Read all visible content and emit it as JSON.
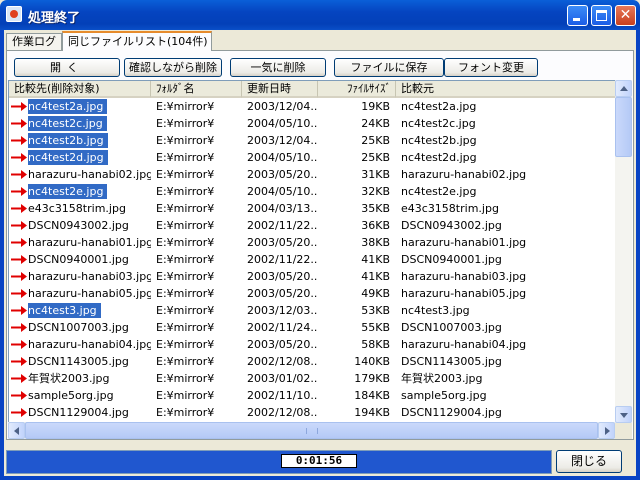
{
  "window": {
    "title": "処理終了",
    "colors": {
      "titlebar": "#0544c0",
      "selection": "#316ac5",
      "arrow": "#e00000",
      "status_bar": "#2057cf"
    }
  },
  "tabs": [
    {
      "label": "作業ログ",
      "active": false
    },
    {
      "label": "同じファイルリスト(104件)",
      "active": true
    }
  ],
  "toolbar": {
    "open": "開く",
    "confirm_delete": "確認しながら削除",
    "bulk_delete": "一気に削除",
    "save_to_file": "ファイルに保存",
    "change_font": "フォント変更"
  },
  "columns": [
    "比較先(削除対象)",
    "ﾌｫﾙﾀﾞ名",
    "更新日時",
    "ﾌｧｲﾙｻｲｽﾞ",
    "比較元"
  ],
  "rows": [
    {
      "target": "nc4test2a.jpg",
      "folder": "E:¥mirror¥",
      "date": "2003/12/04...",
      "size": "19KB",
      "source": "nc4test2a.jpg",
      "selected": true
    },
    {
      "target": "nc4test2c.jpg",
      "folder": "E:¥mirror¥",
      "date": "2004/05/10...",
      "size": "24KB",
      "source": "nc4test2c.jpg",
      "selected": true
    },
    {
      "target": "nc4test2b.jpg",
      "folder": "E:¥mirror¥",
      "date": "2003/12/04...",
      "size": "25KB",
      "source": "nc4test2b.jpg",
      "selected": true
    },
    {
      "target": "nc4test2d.jpg",
      "folder": "E:¥mirror¥",
      "date": "2004/05/10...",
      "size": "25KB",
      "source": "nc4test2d.jpg",
      "selected": true
    },
    {
      "target": "harazuru-hanabi02.jpg",
      "folder": "E:¥mirror¥",
      "date": "2003/05/20...",
      "size": "31KB",
      "source": "harazuru-hanabi02.jpg",
      "selected": false
    },
    {
      "target": "nc4test2e.jpg",
      "folder": "E:¥mirror¥",
      "date": "2004/05/10...",
      "size": "32KB",
      "source": "nc4test2e.jpg",
      "selected": true
    },
    {
      "target": "e43c3158trim.jpg",
      "folder": "E:¥mirror¥",
      "date": "2004/03/13...",
      "size": "35KB",
      "source": "e43c3158trim.jpg",
      "selected": false
    },
    {
      "target": "DSCN0943002.jpg",
      "folder": "E:¥mirror¥",
      "date": "2002/11/22...",
      "size": "36KB",
      "source": "DSCN0943002.jpg",
      "selected": false
    },
    {
      "target": "harazuru-hanabi01.jpg",
      "folder": "E:¥mirror¥",
      "date": "2003/05/20...",
      "size": "38KB",
      "source": "harazuru-hanabi01.jpg",
      "selected": false
    },
    {
      "target": "DSCN0940001.jpg",
      "folder": "E:¥mirror¥",
      "date": "2002/11/22...",
      "size": "41KB",
      "source": "DSCN0940001.jpg",
      "selected": false
    },
    {
      "target": "harazuru-hanabi03.jpg",
      "folder": "E:¥mirror¥",
      "date": "2003/05/20...",
      "size": "41KB",
      "source": "harazuru-hanabi03.jpg",
      "selected": false
    },
    {
      "target": "harazuru-hanabi05.jpg",
      "folder": "E:¥mirror¥",
      "date": "2003/05/20...",
      "size": "49KB",
      "source": "harazuru-hanabi05.jpg",
      "selected": false
    },
    {
      "target": "nc4test3.jpg",
      "folder": "E:¥mirror¥",
      "date": "2003/12/03...",
      "size": "53KB",
      "source": "nc4test3.jpg",
      "selected": true
    },
    {
      "target": "DSCN1007003.jpg",
      "folder": "E:¥mirror¥",
      "date": "2002/11/24...",
      "size": "55KB",
      "source": "DSCN1007003.jpg",
      "selected": false
    },
    {
      "target": "harazuru-hanabi04.jpg",
      "folder": "E:¥mirror¥",
      "date": "2003/05/20...",
      "size": "58KB",
      "source": "harazuru-hanabi04.jpg",
      "selected": false
    },
    {
      "target": "DSCN1143005.jpg",
      "folder": "E:¥mirror¥",
      "date": "2002/12/08...",
      "size": "140KB",
      "source": "DSCN1143005.jpg",
      "selected": false
    },
    {
      "target": "年賀状2003.jpg",
      "folder": "E:¥mirror¥",
      "date": "2003/01/02...",
      "size": "179KB",
      "source": "年賀状2003.jpg",
      "selected": false
    },
    {
      "target": "sample5org.jpg",
      "folder": "E:¥mirror¥",
      "date": "2002/11/10...",
      "size": "184KB",
      "source": "sample5org.jpg",
      "selected": false
    },
    {
      "target": "DSCN1129004.jpg",
      "folder": "E:¥mirror¥",
      "date": "2002/12/08...",
      "size": "194KB",
      "source": "DSCN1129004.jpg",
      "selected": false
    }
  ],
  "status": {
    "elapsed": "0:01:56"
  },
  "close_button": "閉じる"
}
